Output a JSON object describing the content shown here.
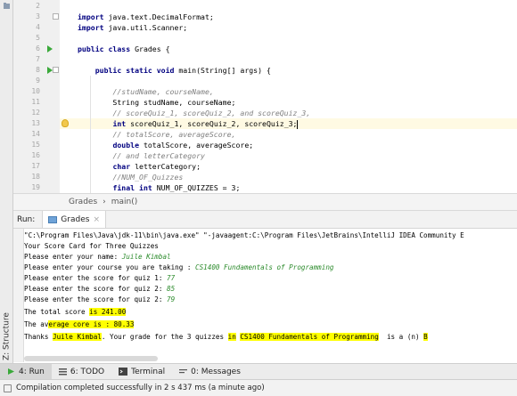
{
  "editor": {
    "lines": [
      {
        "num": "2",
        "tokens": [
          {
            "t": "",
            "c": ""
          }
        ]
      },
      {
        "num": "3",
        "tokens": [
          {
            "t": "import",
            "c": "kw"
          },
          {
            "t": " java.text.DecimalFormat;",
            "c": ""
          }
        ]
      },
      {
        "num": "4",
        "tokens": [
          {
            "t": "import",
            "c": "kw"
          },
          {
            "t": " java.util.Scanner;",
            "c": ""
          }
        ]
      },
      {
        "num": "5",
        "tokens": [
          {
            "t": "",
            "c": ""
          }
        ]
      },
      {
        "num": "6",
        "tokens": [
          {
            "t": "public class",
            "c": "kw"
          },
          {
            "t": " Grades {",
            "c": ""
          }
        ]
      },
      {
        "num": "7",
        "tokens": [
          {
            "t": "",
            "c": ""
          }
        ]
      },
      {
        "num": "8",
        "tokens": [
          {
            "t": "    ",
            "c": ""
          },
          {
            "t": "public static void",
            "c": "kw"
          },
          {
            "t": " main(String[] args) {",
            "c": ""
          }
        ]
      },
      {
        "num": "9",
        "tokens": [
          {
            "t": "",
            "c": ""
          }
        ]
      },
      {
        "num": "10",
        "tokens": [
          {
            "t": "        ",
            "c": ""
          },
          {
            "t": "//studName, courseName,",
            "c": "cm"
          }
        ]
      },
      {
        "num": "11",
        "tokens": [
          {
            "t": "        String studName, courseName;",
            "c": ""
          }
        ]
      },
      {
        "num": "12",
        "tokens": [
          {
            "t": "        ",
            "c": ""
          },
          {
            "t": "// scoreQuiz_1, scoreQuiz_2, and scoreQuiz_3,",
            "c": "cm"
          }
        ]
      },
      {
        "num": "13",
        "tokens": [
          {
            "t": "        ",
            "c": ""
          },
          {
            "t": "int",
            "c": "kw"
          },
          {
            "t": " scoreQuiz_1, scoreQuiz_2, scoreQuiz_3;",
            "c": ""
          }
        ]
      },
      {
        "num": "14",
        "tokens": [
          {
            "t": "        ",
            "c": ""
          },
          {
            "t": "// totalScore, averageScore,",
            "c": "cm"
          }
        ]
      },
      {
        "num": "15",
        "tokens": [
          {
            "t": "        ",
            "c": ""
          },
          {
            "t": "double",
            "c": "kw"
          },
          {
            "t": " totalScore, averageScore;",
            "c": ""
          }
        ]
      },
      {
        "num": "16",
        "tokens": [
          {
            "t": "        ",
            "c": ""
          },
          {
            "t": "// and letterCategory",
            "c": "cm"
          }
        ]
      },
      {
        "num": "17",
        "tokens": [
          {
            "t": "        ",
            "c": ""
          },
          {
            "t": "char",
            "c": "kw"
          },
          {
            "t": " letterCategory;",
            "c": ""
          }
        ]
      },
      {
        "num": "18",
        "tokens": [
          {
            "t": "        ",
            "c": ""
          },
          {
            "t": "//NUM_OF_Quizzes",
            "c": "cm"
          }
        ]
      },
      {
        "num": "19",
        "tokens": [
          {
            "t": "        ",
            "c": ""
          },
          {
            "t": "final int",
            "c": "kw"
          },
          {
            "t": " NUM_OF_QUIZZES = 3;",
            "c": ""
          }
        ]
      }
    ]
  },
  "breadcrumb": {
    "class_name": "Grades",
    "separator": "›",
    "method": "main()"
  },
  "run_panel": {
    "label": "Run:",
    "tab_label": "Grades",
    "tab_close": "×"
  },
  "console": {
    "command": "\"C:\\Program Files\\Java\\jdk-11\\bin\\java.exe\" \"-javaagent:C:\\Program Files\\JetBrains\\IntelliJ IDEA Community E",
    "title_line": "Your Score Card for Three Quizzes",
    "prompt_name": "Please enter your name: ",
    "input_name": "Juile Kimbal",
    "prompt_course": "Please enter your course you are taking : ",
    "input_course": "CS1400 Fundamentals of Programming",
    "prompt_q1": "Please enter the score for quiz 1: ",
    "input_q1": "77",
    "prompt_q2": "Please enter the score for quiz 2: ",
    "input_q2": "85",
    "prompt_q3": "Please enter the score for quiz 2: ",
    "input_q3": "79",
    "total_prefix": "The total score ",
    "total_hl": "is 241.00",
    "avg_prefix": "The av",
    "avg_hl": "erage core is : 80.33",
    "thanks_a": "Thanks ",
    "thanks_name": "Juile Kimbal",
    "thanks_b": ". Your grade for the 3 quizzes ",
    "thanks_in": "in",
    "thanks_c": " ",
    "thanks_course": "CS1400 Fundamentals of Programming",
    "thanks_d": "  is a (n) ",
    "thanks_grade": "B"
  },
  "toolbar": {
    "run": "4: Run",
    "todo": "6: TODO",
    "terminal": "Terminal",
    "messages": "0: Messages"
  },
  "sidebar": {
    "structure": "Z: Structure"
  },
  "status": {
    "message": "Compilation completed successfully in 2 s 437 ms (a minute ago)"
  }
}
